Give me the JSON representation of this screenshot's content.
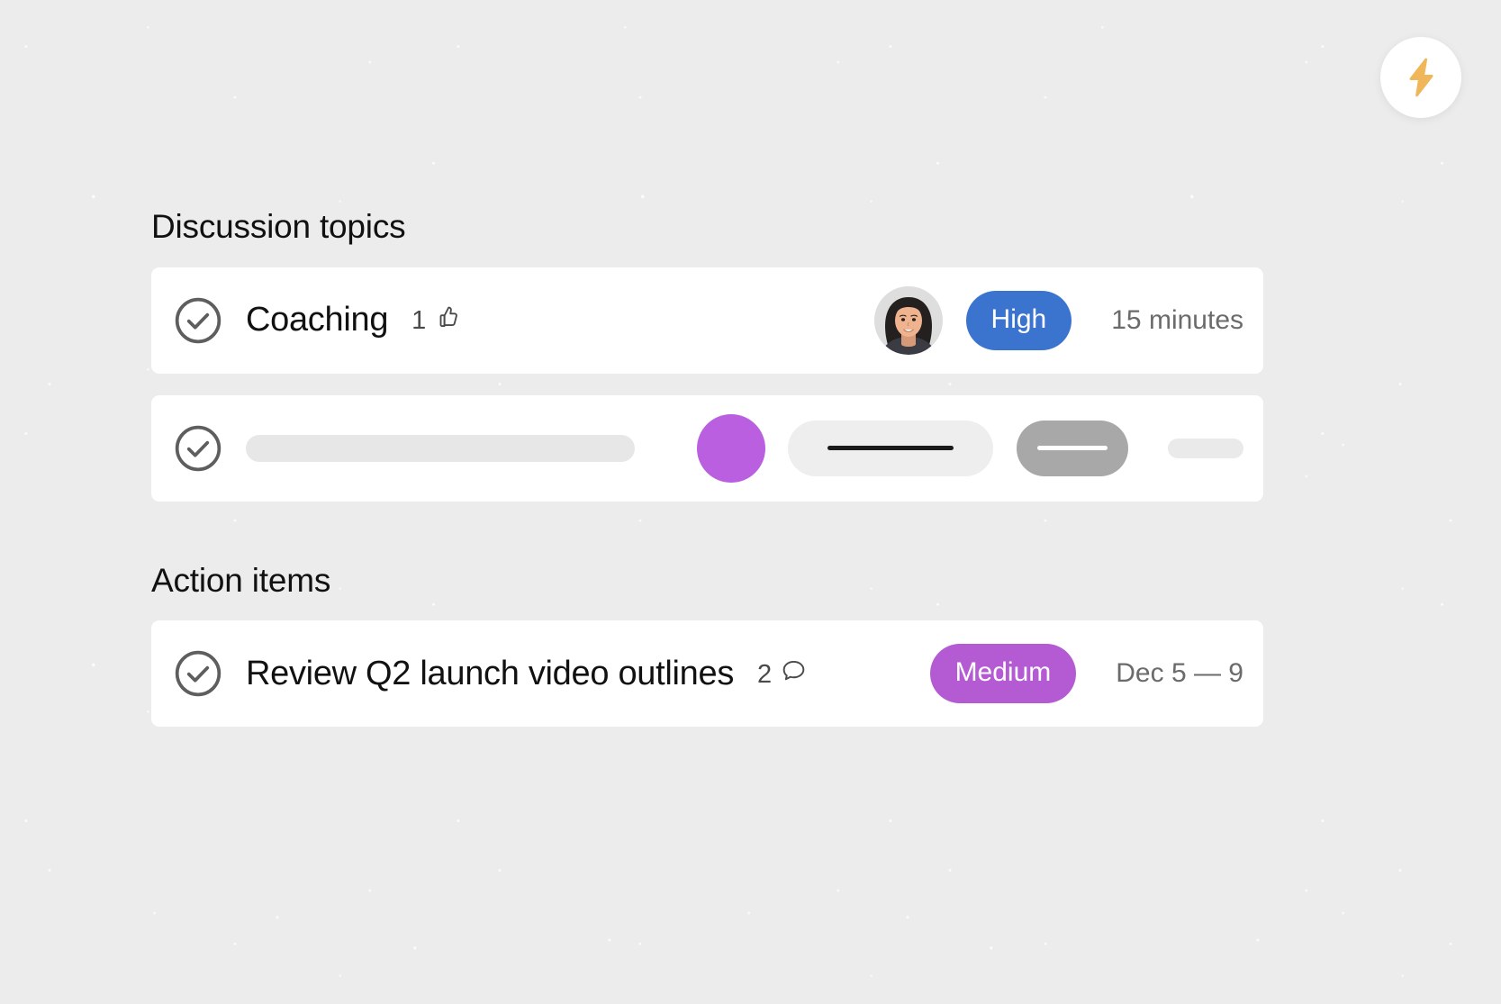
{
  "fab": {
    "icon": "lightning-bolt-icon",
    "color": "#efb65a",
    "background": "#ffffff"
  },
  "colors": {
    "page_background": "#ececec",
    "card_background": "#ffffff",
    "priority_high": "#3b74cf",
    "priority_medium": "#b45bd4",
    "skeleton_dot": "#b95fe0",
    "skeleton_light": "#e7e7e7",
    "skeleton_dark": "#a8a8a8",
    "text_primary": "#111111",
    "text_muted": "#6b6b6b",
    "check_icon": "#5e5e5e"
  },
  "sections": [
    {
      "id": "discussion-topics",
      "title": "Discussion topics",
      "rows": [
        {
          "type": "content",
          "check_icon": "check-circle-icon",
          "title": "Coaching",
          "reaction_count": "1",
          "reaction_icon": "thumbs-up-icon",
          "avatar": "user-avatar",
          "priority_label": "High",
          "priority_color": "#3b74cf",
          "right_meta": "15 minutes"
        },
        {
          "type": "skeleton",
          "check_icon": "check-circle-icon"
        }
      ]
    },
    {
      "id": "action-items",
      "title": "Action items",
      "rows": [
        {
          "type": "content",
          "check_icon": "check-circle-icon",
          "title": "Review Q2 launch video outlines",
          "reaction_count": "2",
          "reaction_icon": "comment-bubble-icon",
          "priority_label": "Medium",
          "priority_color": "#b45bd4",
          "right_meta": "Dec 5 — 9"
        }
      ]
    }
  ]
}
